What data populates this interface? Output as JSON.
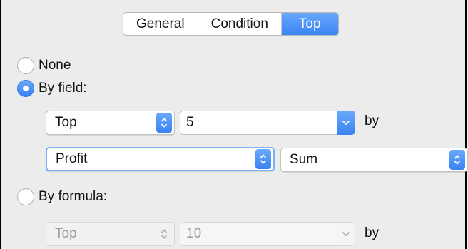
{
  "tabs": [
    {
      "label": "General",
      "active": false
    },
    {
      "label": "Condition",
      "active": false
    },
    {
      "label": "Top",
      "active": true
    }
  ],
  "options": {
    "none_label": "None",
    "by_field_label": "By field:",
    "by_formula_label": "By formula:",
    "selected": "by_field"
  },
  "by_field": {
    "direction": "Top",
    "count": "5",
    "by_label": "by",
    "field": "Profit",
    "aggregation": "Sum"
  },
  "by_formula": {
    "direction": "Top",
    "count": "10",
    "by_label": "by"
  },
  "colors": {
    "accent": "#3a84f4",
    "background": "#ececec",
    "disabled_text": "#9c9c9c"
  }
}
